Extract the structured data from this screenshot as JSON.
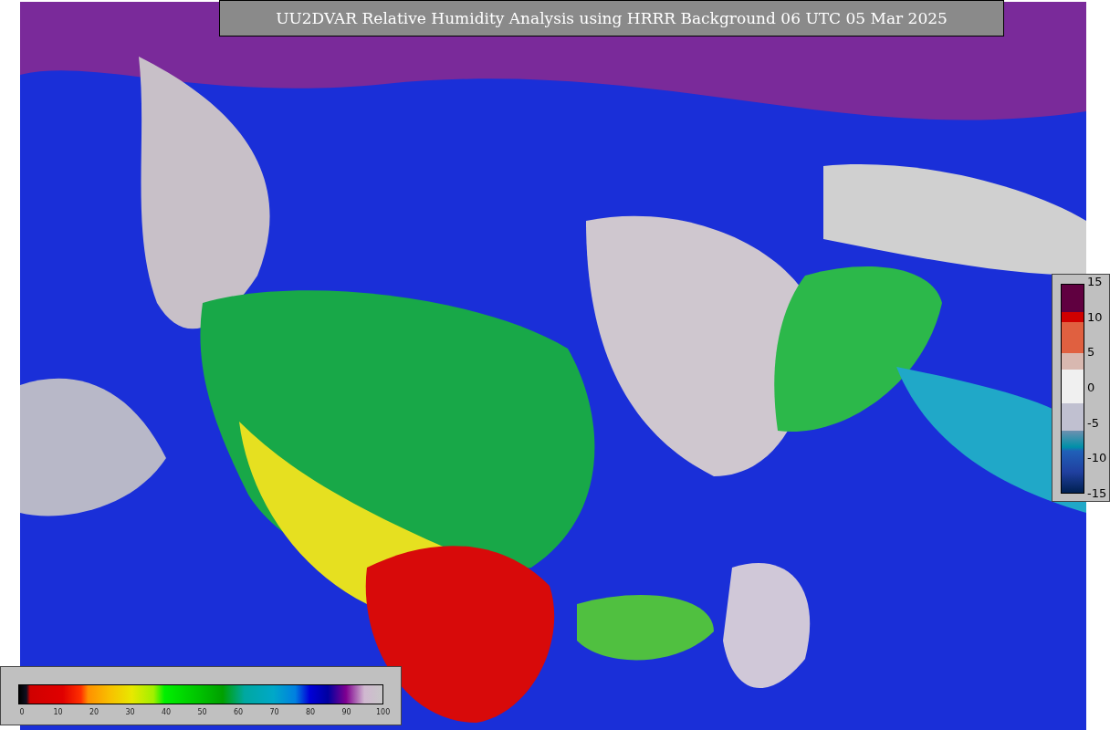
{
  "title": "UU2DVAR Relative Humidity Analysis using HRRR Background 06 UTC 05 Mar 2025",
  "humidity_legend": {
    "ticks": [
      "0",
      "10",
      "20",
      "30",
      "40",
      "50",
      "60",
      "70",
      "80",
      "90",
      "100"
    ]
  },
  "change_legend": {
    "ticks": [
      "15",
      "10",
      "5",
      "0",
      "-5",
      "-10",
      "-15"
    ]
  }
}
